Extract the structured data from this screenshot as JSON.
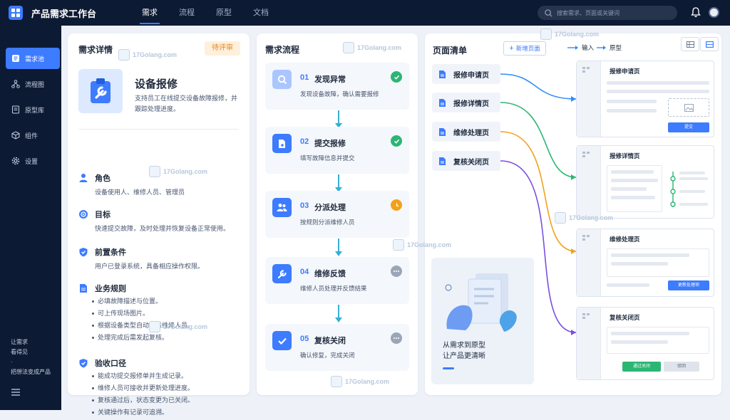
{
  "app": {
    "title": "产品需求工作台"
  },
  "nav": {
    "tabs": [
      "需求",
      "流程",
      "原型",
      "文档"
    ],
    "active": "需求"
  },
  "search": {
    "placeholder": "搜索需求、页面或关键词"
  },
  "sidebar": {
    "items": [
      {
        "label": "需求池",
        "icon": "list-icon",
        "active": true
      },
      {
        "label": "流程图",
        "icon": "flowchart-icon"
      },
      {
        "label": "原型库",
        "icon": "document-icon"
      },
      {
        "label": "组件",
        "icon": "cube-icon"
      },
      {
        "label": "设置",
        "icon": "gear-icon"
      }
    ],
    "footer": [
      "让需求",
      "看得见",
      "·",
      "把想法变成产品"
    ]
  },
  "detail": {
    "title": "需求详情",
    "status": "待评审",
    "name": "设备报修",
    "desc": "支持员工在线提交设备故障报修，并跟踪处理进度。",
    "sections": {
      "role": {
        "title": "角色",
        "body": "设备使用人、维修人员、管理员"
      },
      "goal": {
        "title": "目标",
        "body": "快速提交故障，及时处理并恢复设备正常使用。"
      },
      "pre": {
        "title": "前置条件",
        "body": "用户已登录系统，具备相应操作权限。"
      },
      "rules": {
        "title": "业务规则",
        "items": [
          "必填故障描述与位置。",
          "可上传现场图片。",
          "根据设备类型自动分派维修人员。",
          "处理完成后需发起复核。"
        ]
      },
      "accept": {
        "title": "验收口径",
        "items": [
          "能成功提交报修单并生成记录。",
          "维修人员可接收并更新处理进度。",
          "复核通过后，状态变更为已关闭。",
          "关键操作有记录可追溯。"
        ]
      }
    }
  },
  "flow": {
    "title": "需求流程",
    "steps": [
      {
        "num": "01",
        "name": "发现异常",
        "desc": "发现设备故障，确认需要报修",
        "status": "done"
      },
      {
        "num": "02",
        "name": "提交报修",
        "desc": "填写故障信息并提交",
        "status": "done"
      },
      {
        "num": "03",
        "name": "分派处理",
        "desc": "按规则分派维修人员",
        "status": "in-progress"
      },
      {
        "num": "04",
        "name": "维修反馈",
        "desc": "维修人员处理并反馈结果",
        "status": "pending"
      },
      {
        "num": "05",
        "name": "复核关闭",
        "desc": "确认修复，完成关闭",
        "status": "pending"
      }
    ]
  },
  "pages": {
    "title": "页面清单",
    "add_label": "新增页面",
    "legend": {
      "input": "输入",
      "output": "原型"
    },
    "items": [
      "报修申请页",
      "报修详情页",
      "维修处理页",
      "复核关闭页"
    ],
    "illus_text": [
      "从需求到原型",
      "让产品更清晰"
    ],
    "cards": [
      {
        "title": "报修申请页",
        "button": "提交"
      },
      {
        "title": "报修详情页"
      },
      {
        "title": "维修处理页",
        "button": "更新处理项"
      },
      {
        "title": "复核关闭页",
        "buttons": [
          "通过关闭",
          "驳回"
        ]
      }
    ],
    "link_colors": [
      "#2f8cff",
      "#2bb673",
      "#f2a11a",
      "#7b4fe0"
    ]
  },
  "watermark": "17Golang.com",
  "colors": {
    "accent": "#3d7bff",
    "done": "#2bb673",
    "progress": "#f2a11a",
    "pending": "#9aa6b8"
  }
}
